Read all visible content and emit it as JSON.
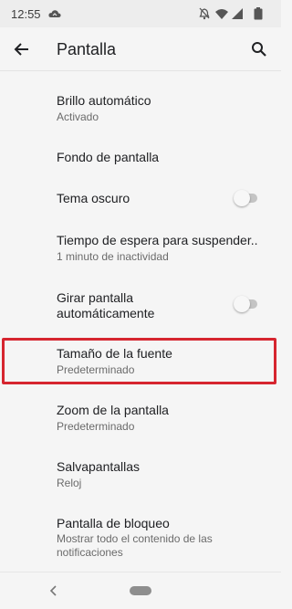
{
  "status_bar": {
    "time": "12:55",
    "icons": [
      "cloud-icon",
      "notifications-off-icon",
      "wifi-icon",
      "signal-icon",
      "battery-icon"
    ]
  },
  "app_bar": {
    "title": "Pantalla",
    "back_icon": "arrow-back-icon",
    "search_icon": "search-icon"
  },
  "settings": {
    "items": [
      {
        "title": "Brillo automático",
        "summary": "Activado"
      },
      {
        "title": "Fondo de pantalla"
      },
      {
        "title": "Tema oscuro",
        "toggle": "off"
      },
      {
        "title": "Tiempo de espera para suspender..",
        "summary": "1 minuto de inactividad"
      },
      {
        "title": "Girar pantalla",
        "title_line2": "automáticamente",
        "toggle": "off"
      },
      {
        "title": "Tamaño de la fuente",
        "summary": "Predeterminado",
        "highlighted": true
      },
      {
        "title": "Zoom de la pantalla",
        "summary": "Predeterminado"
      },
      {
        "title": "Salvapantallas",
        "summary": "Reloj"
      },
      {
        "title": "Pantalla de bloqueo",
        "summary": "Mostrar todo el contenido de las",
        "summary_line2": "notificaciones"
      }
    ]
  },
  "colors": {
    "background": "#f5f5f5",
    "highlight": "#d6252f",
    "toggle_track_off": "#c4c4c4"
  }
}
